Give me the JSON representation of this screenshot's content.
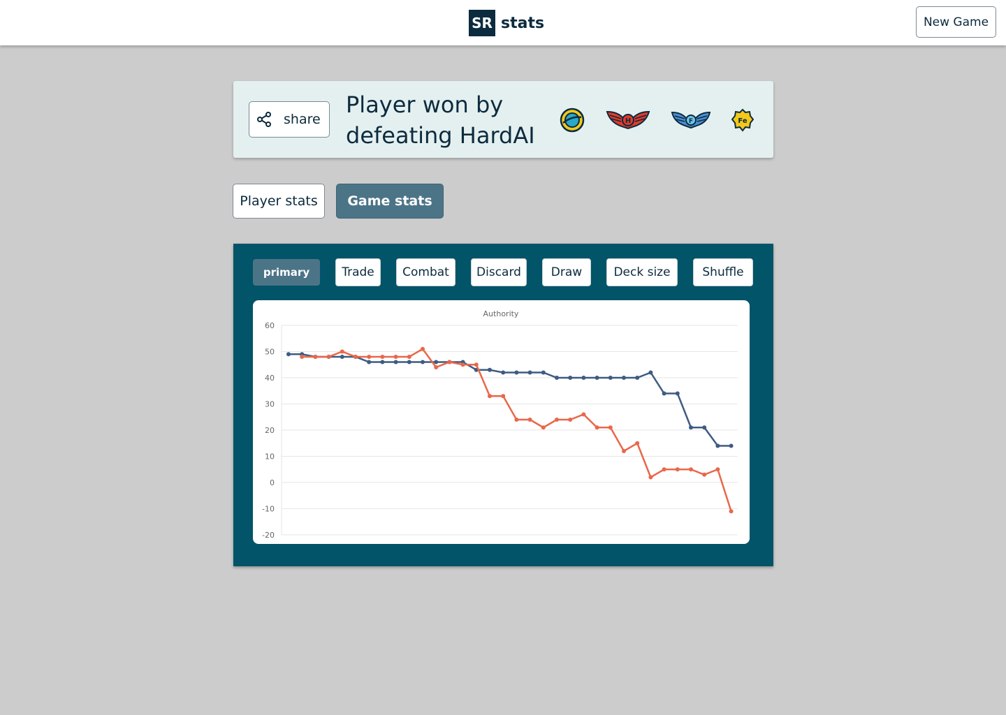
{
  "header": {
    "logo_badge": "SR",
    "logo_text": "stats",
    "new_game_label": "New Game"
  },
  "result": {
    "share_label": "share",
    "title": "Player won by defeating HardAI",
    "faction_icons": [
      "machine-cult-icon",
      "star-empire-icon",
      "trade-federation-icon",
      "blob-icon"
    ]
  },
  "tabs": {
    "player_stats": "Player stats",
    "game_stats": "Game stats",
    "active": "Game stats"
  },
  "sub_tabs": {
    "items": [
      "primary",
      "Trade",
      "Combat",
      "Discard",
      "Draw",
      "Deck size",
      "Shuffle"
    ],
    "active": "primary"
  },
  "colors": {
    "series_blue": "#3e5b82",
    "series_orange": "#e8684a",
    "panel": "#025468",
    "active_tab": "#4c7487"
  },
  "chart_data": {
    "type": "line",
    "title": "Authority",
    "ylim": [
      -20,
      60
    ],
    "yticks": [
      60,
      50,
      40,
      30,
      20,
      10,
      0,
      -10,
      -20
    ],
    "grid": true,
    "series": [
      {
        "color": "#3e5b82",
        "start_index": 0,
        "values": [
          49,
          49,
          48,
          48,
          48,
          48,
          46,
          46,
          46,
          46,
          46,
          46,
          46,
          46,
          43,
          43,
          42,
          42,
          42,
          42,
          40,
          40,
          40,
          40,
          40,
          40,
          40,
          42,
          34,
          34,
          21,
          21,
          14,
          14
        ]
      },
      {
        "color": "#e8684a",
        "start_index": 1,
        "values": [
          48,
          48,
          48,
          50,
          48,
          48,
          48,
          48,
          48,
          51,
          44,
          46,
          45,
          45,
          33,
          33,
          24,
          24,
          21,
          24,
          24,
          26,
          21,
          21,
          12,
          15,
          2,
          5,
          5,
          5,
          3,
          5,
          -11
        ]
      }
    ]
  }
}
